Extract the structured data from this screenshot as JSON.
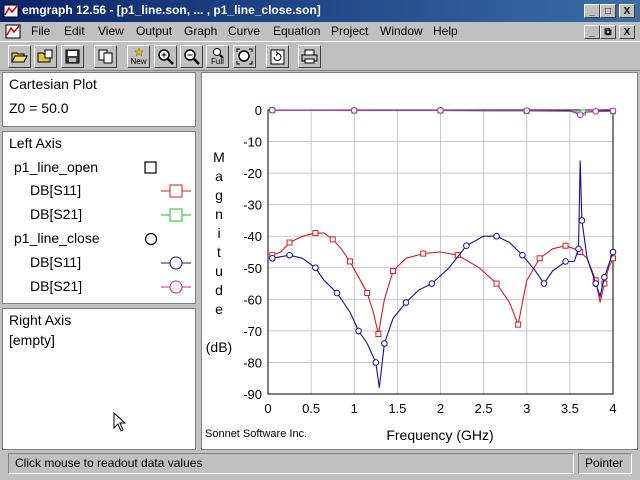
{
  "window": {
    "title": "emgraph 12.56 - [p1_line.son, ... , p1_line_close.son]",
    "min_label": "_",
    "max_label": "□",
    "close_label": "X",
    "restore_label": "⧉"
  },
  "menu": [
    "File",
    "Edit",
    "View",
    "Output",
    "Graph",
    "Curve",
    "Equation",
    "Project",
    "Window",
    "Help"
  ],
  "toolbar": {
    "buttons": [
      "open-icon",
      "open-multi-icon",
      "save-icon",
      "copy-icon",
      "new-icon",
      "zoom-in-icon",
      "zoom-out-icon",
      "zoom-full-icon",
      "zoom-fit-icon",
      "refresh-icon",
      "print-icon"
    ],
    "new_label": "New",
    "full_label": "Full"
  },
  "info": {
    "plot_type": "Cartesian Plot",
    "z0": "Z0 = 50.0"
  },
  "left_axis": {
    "heading": "Left Axis",
    "groups": [
      {
        "name": "p1_line_open",
        "marker": "square",
        "curves": [
          {
            "label": "DB[S11]",
            "color": "#d02020"
          },
          {
            "label": "DB[S21]",
            "color": "#20c020"
          }
        ]
      },
      {
        "name": "p1_line_close",
        "marker": "circle",
        "curves": [
          {
            "label": "DB[S11]",
            "color": "#1010a0"
          },
          {
            "label": "DB[S21]",
            "color": "#c020c0"
          }
        ]
      }
    ]
  },
  "right_axis": {
    "heading": "Right Axis",
    "value": "[empty]"
  },
  "status": {
    "message": "Click mouse to readout data values",
    "mode": "Pointer"
  },
  "chart_data": {
    "type": "line",
    "ylabel_chars": [
      "M",
      "a",
      "g",
      "n",
      "i",
      "t",
      "u",
      "d",
      "e"
    ],
    "ylabel_unit": "(dB)",
    "xlabel": "Frequency (GHz)",
    "credit": "Sonnet Software Inc.",
    "xlim": [
      0,
      4
    ],
    "ylim": [
      -90,
      0
    ],
    "xticks": [
      "0",
      "0.5",
      "1",
      "1.5",
      "2",
      "2.5",
      "3",
      "3.5",
      "4"
    ],
    "yticks": [
      "0",
      "-10",
      "-20",
      "-30",
      "-40",
      "-50",
      "-60",
      "-70",
      "-80",
      "-90"
    ],
    "series": [
      {
        "name": "p1_line_open DB[S11]",
        "color": "#d02020",
        "marker": "square",
        "x": [
          0.05,
          0.15,
          0.25,
          0.4,
          0.55,
          0.65,
          0.75,
          0.85,
          0.95,
          1.05,
          1.15,
          1.22,
          1.28,
          1.35,
          1.45,
          1.6,
          1.8,
          2.0,
          2.2,
          2.45,
          2.65,
          2.8,
          2.9,
          3.0,
          3.15,
          3.3,
          3.45,
          3.55,
          3.62,
          3.7,
          3.8,
          3.85,
          3.9,
          3.95,
          4.0
        ],
        "y": [
          -46,
          -45,
          -42,
          -40,
          -39,
          -39,
          -41,
          -44,
          -48,
          -53,
          -58,
          -64,
          -71,
          -60,
          -51,
          -47,
          -45.5,
          -45,
          -46,
          -50,
          -55,
          -61,
          -68,
          -54,
          -47,
          -44,
          -43,
          -44,
          -45,
          -47,
          -54,
          -61,
          -55,
          -50,
          -47
        ]
      },
      {
        "name": "p1_line_open DB[S21]",
        "color": "#20c020",
        "marker": "square",
        "x": [
          0.05,
          0.5,
          1.0,
          1.5,
          2.0,
          2.5,
          3.0,
          3.5,
          3.65,
          3.8,
          4.0
        ],
        "y": [
          -0.1,
          -0.1,
          -0.2,
          -0.2,
          -0.2,
          -0.3,
          -0.3,
          -0.4,
          -0.8,
          -0.5,
          -0.4
        ]
      },
      {
        "name": "p1_line_close DB[S11]",
        "color": "#1010a0",
        "marker": "circle",
        "x": [
          0.05,
          0.15,
          0.25,
          0.4,
          0.55,
          0.65,
          0.8,
          0.95,
          1.05,
          1.15,
          1.25,
          1.29,
          1.35,
          1.45,
          1.6,
          1.75,
          1.9,
          2.1,
          2.3,
          2.5,
          2.65,
          2.8,
          2.95,
          3.1,
          3.2,
          3.3,
          3.45,
          3.55,
          3.6,
          3.62,
          3.64,
          3.7,
          3.8,
          3.85,
          3.9,
          3.95,
          4.0
        ],
        "y": [
          -47,
          -46.5,
          -46,
          -47,
          -50,
          -54,
          -58,
          -64,
          -70,
          -74,
          -80,
          -88,
          -74,
          -66,
          -61,
          -57,
          -55,
          -50,
          -43,
          -40,
          -40,
          -42,
          -46,
          -51,
          -55,
          -51,
          -48,
          -48,
          -44,
          -16,
          -35,
          -47,
          -55,
          -59,
          -53,
          -49,
          -45
        ]
      },
      {
        "name": "p1_line_close DB[S21]",
        "color": "#c020c0",
        "marker": "circle",
        "x": [
          0.05,
          0.5,
          1.0,
          1.5,
          2.0,
          2.5,
          3.0,
          3.5,
          3.62,
          3.7,
          3.8,
          4.0
        ],
        "y": [
          -0.05,
          -0.05,
          -0.1,
          -0.1,
          -0.1,
          -0.15,
          -0.2,
          -0.3,
          -1.5,
          -0.6,
          -0.4,
          -0.3
        ]
      }
    ]
  }
}
